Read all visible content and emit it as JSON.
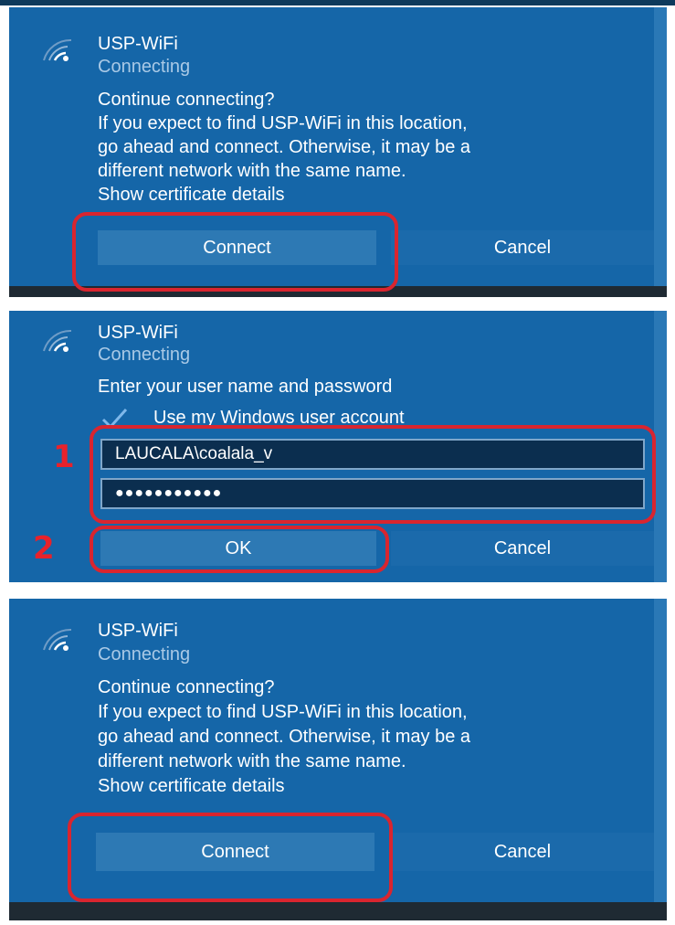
{
  "panels": [
    {
      "ssid": "USP-WiFi",
      "status": "Connecting",
      "message_lines": [
        "Continue connecting?",
        "If you expect to find USP-WiFi in this location,",
        "go ahead and connect. Otherwise, it may be a",
        "different network with the same name.",
        "Show certificate details"
      ],
      "primary_button": "Connect",
      "secondary_button": "Cancel"
    },
    {
      "ssid": "USP-WiFi",
      "status": "Connecting",
      "prompt": "Enter your user name and password",
      "checkbox_label": "Use my Windows user account",
      "checkbox_checked": true,
      "username_value": "LAUCALA\\coalala_v",
      "password_value": "●●●●●●●●●●●",
      "step_labels": [
        "1",
        "2"
      ],
      "primary_button": "OK",
      "secondary_button": "Cancel"
    },
    {
      "ssid": "USP-WiFi",
      "status": "Connecting",
      "message_lines": [
        "Continue connecting?",
        "If you expect to find USP-WiFi in this location,",
        "go ahead and connect. Otherwise, it may be a",
        "different network with the same name.",
        "Show certificate details"
      ],
      "primary_button": "Connect",
      "secondary_button": "Cancel"
    }
  ],
  "colors": {
    "panel_bg": "#1566a8",
    "button_primary": "#2d79b4",
    "highlight": "#d9252f",
    "input_bg": "#0b2e4f"
  }
}
